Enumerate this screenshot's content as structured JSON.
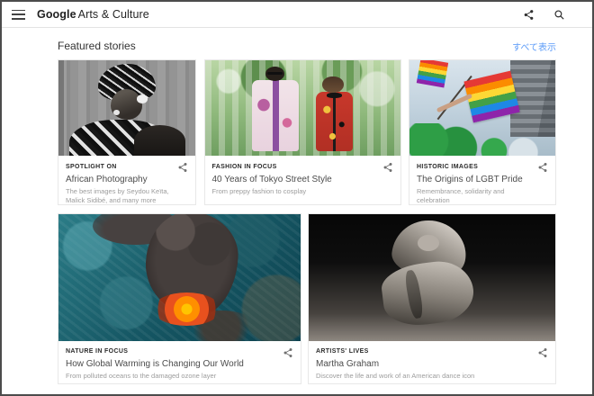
{
  "topbar": {
    "logo": {
      "primary": "Google",
      "secondary": "Arts & Culture"
    },
    "icons": {
      "menu": "hamburger",
      "share": "share-nodes",
      "search": "magnifier"
    }
  },
  "section": {
    "title": "Featured stories",
    "show_all_label": "すべて表示"
  },
  "cards": [
    {
      "category": "SPOTLIGHT ON",
      "title": "African Photography",
      "description": "The best images by Seydou Keïta, Malick Sidibé, and many more",
      "image_desc": "black and white portrait of a woman with patterned head wrap"
    },
    {
      "category": "FASHION IN FOCUS",
      "title": "40 Years of Tokyo Street Style",
      "description": "From preppy fashion to cosplay",
      "image_desc": "two young people in colorful outfits on a sunny Tokyo street"
    },
    {
      "category": "HISTORIC IMAGES",
      "title": "The Origins of LGBT Pride",
      "description": "Remembrance, solidarity and celebration",
      "image_desc": "rainbow flags waved at a pride parade in front of a city building"
    },
    {
      "category": "NATURE IN FOCUS",
      "title": "How Global Warming is Changing Our World",
      "description": "From polluted oceans to the damaged ozone layer",
      "image_desc": "aerial view of a volcanic eruption with dark smoke and lava over teal ocean"
    },
    {
      "category": "ARTISTS' LIVES",
      "title": "Martha Graham",
      "description": "Discover the life and work of an American dance icon",
      "image_desc": "black and white photograph of a dancer in draped fabric"
    }
  ],
  "colors": {
    "link_blue": "#5b9bf8",
    "category_text": "#2a2a2a",
    "title_text": "#4c4c4c",
    "description_text": "#9c9c9c",
    "card_border": "#e8e8e8",
    "topbar_border": "#e3e3e3",
    "frame_border": "#4c4c4c",
    "pride_flag_stripes": [
      "#e53935",
      "#fb8c00",
      "#fdd835",
      "#43a047",
      "#1e88e5",
      "#8e24aa"
    ]
  }
}
